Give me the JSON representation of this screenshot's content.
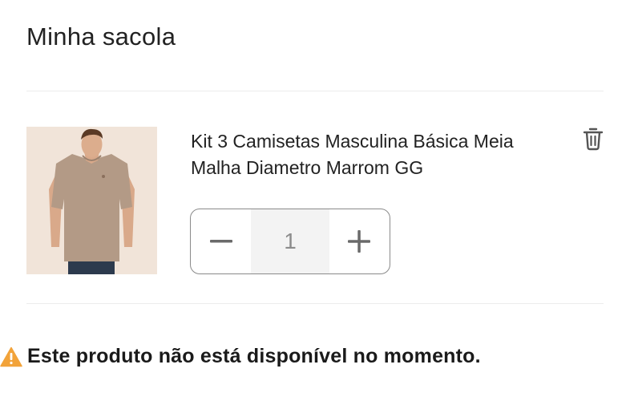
{
  "bag": {
    "title": "Minha sacola"
  },
  "item": {
    "name": "Kit 3 Camisetas Masculina Básica Meia Malha Diametro Marrom GG",
    "quantity": "1",
    "image_alt": "product-photo"
  },
  "icons": {
    "delete": "trash-icon",
    "decrease": "minus-icon",
    "increase": "plus-icon",
    "alert": "warning-icon"
  },
  "warning": {
    "message": "Este produto não está disponível no momento."
  },
  "colors": {
    "warning": "#f2a33a",
    "icon": "#555555",
    "border": "#8a8a8a",
    "image_bg": "#f1e4d9",
    "shirt": "#b39a86"
  }
}
